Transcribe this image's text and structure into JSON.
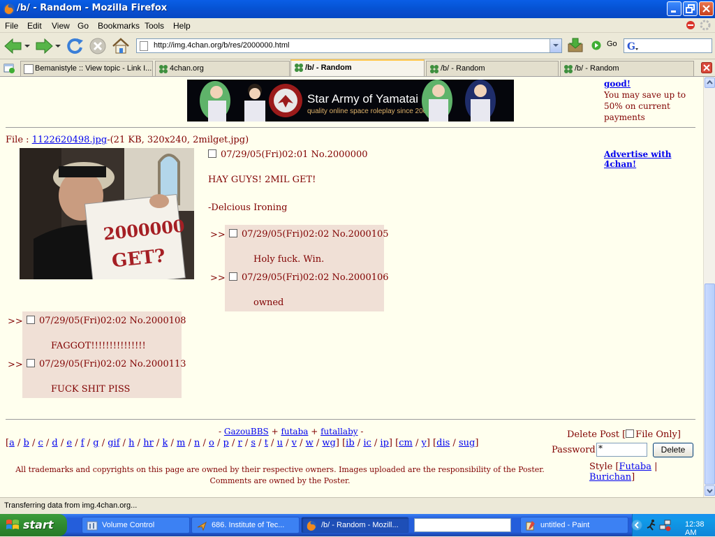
{
  "window": {
    "title": "/b/ - Random - Mozilla Firefox"
  },
  "menu": [
    "File",
    "Edit",
    "View",
    "Go",
    "Bookmarks",
    "Tools",
    "Help"
  ],
  "nav": {
    "url": "http://img.4chan.org/b/res/2000000.html",
    "go_label": "Go"
  },
  "tabs": [
    {
      "label": "Bemanistyle :: View topic - Link I...",
      "active": false
    },
    {
      "label": "4chan.org",
      "active": false
    },
    {
      "label": "/b/ - Random",
      "active": true
    },
    {
      "label": "/b/ - Random",
      "active": false
    },
    {
      "label": "/b/ - Random",
      "active": false
    }
  ],
  "banner": {
    "title": "Star Army of Yamatai",
    "subtitle": "quality online space roleplay since 2000"
  },
  "top_ad": {
    "link": "good!",
    "text": "You may save up to 50% on current payments"
  },
  "op": {
    "file_label": "File :",
    "file_name": "1122620498.jpg",
    "file_meta": "-(21 KB, 320x240, 2milget.jpg)",
    "date": "07/29/05(Fri)02:01",
    "number": "No.2000000",
    "sign_line1": "2000000",
    "sign_line2": "GET?",
    "body_line1": "HAY GUYS! 2MIL GET!",
    "body_line2": "-Delcious Ironing"
  },
  "advertise": "Advertise with 4chan!",
  "replies": [
    {
      "date": "07/29/05(Fri)02:02",
      "number": "No.2000105",
      "body": "Holy fuck. Win."
    },
    {
      "date": "07/29/05(Fri)02:02",
      "number": "No.2000106",
      "body": "owned"
    },
    {
      "date": "07/29/05(Fri)02:02",
      "number": "No.2000108",
      "body": "FAGGOT!!!!!!!!!!!!!!!"
    },
    {
      "date": "07/29/05(Fri)02:02",
      "number": "No.2000113",
      "body": "FUCK SHIT PISS"
    }
  ],
  "reply_marker": ">>",
  "footer": {
    "credits": [
      "GazouBBS",
      "futaba",
      "futallaby"
    ],
    "boards_group1": [
      "a",
      "b",
      "c",
      "d",
      "e",
      "f",
      "g",
      "gif",
      "h",
      "hr",
      "k",
      "m",
      "n",
      "o",
      "p",
      "r",
      "s",
      "t",
      "u",
      "v",
      "w",
      "wg"
    ],
    "boards_group2": [
      "ib",
      "ic",
      "ip"
    ],
    "boards_group3": [
      "cm",
      "y"
    ],
    "boards_group4": [
      "dis",
      "sug"
    ],
    "delete_post": "Delete Post [",
    "file_only": "File Only]",
    "password_label": "Password",
    "password_value": "*",
    "delete_button": "Delete",
    "style_label": "Style [",
    "style_futaba": "Futaba",
    "style_sep": "|",
    "style_burichan": "Burichan",
    "style_close": "]",
    "disclaimer": "All trademarks and copyrights on this page are owned by their respective owners. Images uploaded are the responsibility of the Poster. Comments are owned by the Poster."
  },
  "status": "Transferring data from img.4chan.org...",
  "taskbar": {
    "start": "start",
    "tasks": [
      {
        "label": "Volume Control",
        "active": false
      },
      {
        "label": "686. Institute of Tec...",
        "active": false
      },
      {
        "label": "/b/ - Random - Mozill...",
        "active": true
      },
      {
        "label": "untitled - Paint",
        "active": false
      }
    ],
    "clock": "12:38 AM"
  },
  "colors": {
    "page_bg": "#ffffee",
    "post_text": "#800000",
    "reply_bg": "#f0e0d6",
    "link": "#0000ee"
  }
}
